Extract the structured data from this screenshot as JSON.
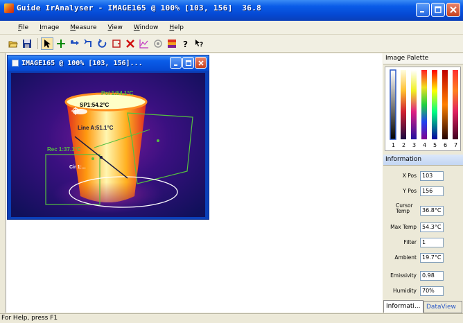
{
  "window": {
    "title": "Guide IrAnalyser - IMAGE165 @ 100% [103, 156]  36.8"
  },
  "menu": [
    "File",
    "Image",
    "Measure",
    "View",
    "Window",
    "Help"
  ],
  "toolbar": {
    "icons": [
      "open-icon",
      "save-icon",
      "pointer-icon",
      "spot-tool-icon",
      "line-tool-icon",
      "area-tool-icon",
      "polygon-tool-icon",
      "rectangle-tool-icon",
      "delete-icon",
      "chart-icon",
      "target-icon",
      "palette-icon",
      "help-icon",
      "context-help-icon"
    ]
  },
  "child_window": {
    "title": "IMAGE165 @ 100% [103, 156]...",
    "labels": {
      "spot": "SP1:54.2°C",
      "line": "Line A:51.1°C",
      "rect": "Rec 1:37.1°C",
      "poly": "Pol 1:54.1°C",
      "circle": "Cir 1:..."
    }
  },
  "palette": {
    "title": "Image Palette",
    "numbers": [
      "1",
      "2",
      "3",
      "4",
      "5",
      "6",
      "7"
    ],
    "selected": "1"
  },
  "information": {
    "title": "Information",
    "rows": [
      {
        "label": "X Pos",
        "value": "103"
      },
      {
        "label": "Y Pos",
        "value": "156"
      },
      {
        "label": "Cursor Temp",
        "value": "36.8°C"
      },
      {
        "label": "Max Temp",
        "value": "54.3°C"
      },
      {
        "label": "Filter",
        "value": "1"
      },
      {
        "label": "Ambient",
        "value": "19.7°C"
      },
      {
        "label": "Emissivity",
        "value": "0.98"
      },
      {
        "label": "Humidity",
        "value": "70%"
      }
    ]
  },
  "tabs": [
    "Informati...",
    "DataView"
  ],
  "status": "For Help, press F1"
}
